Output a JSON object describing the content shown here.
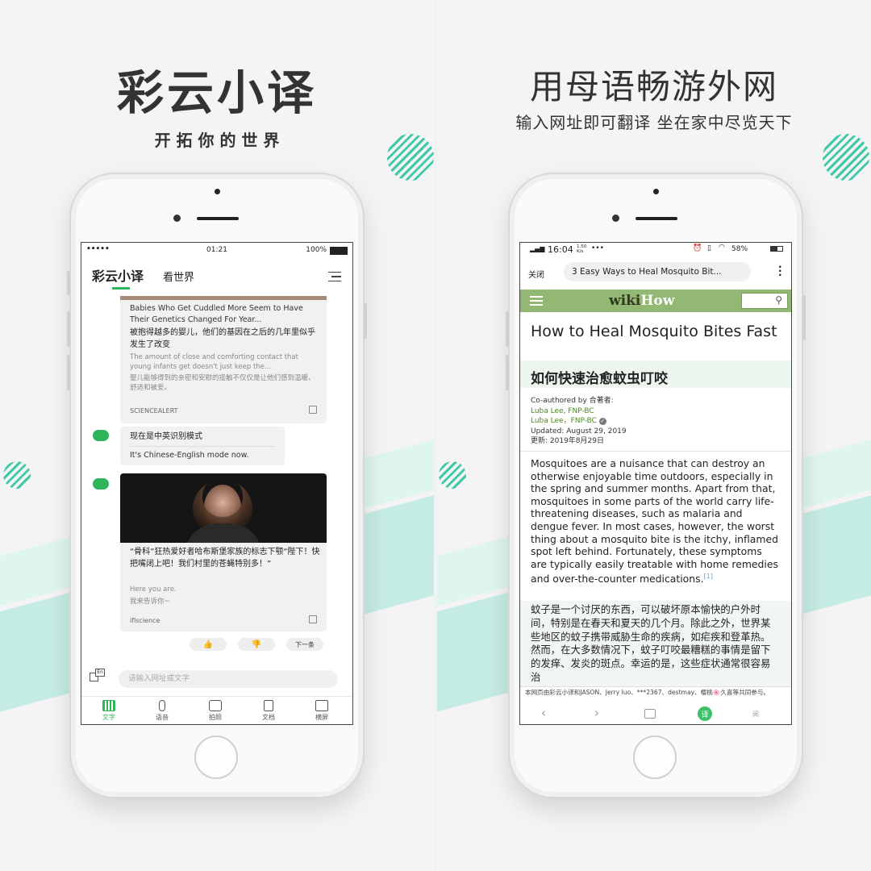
{
  "left_panel": {
    "title": "彩云小译",
    "subtitle": "开 拓 你 的 世 界",
    "status": {
      "signal": "•••••",
      "time": "01:21",
      "battery": "100%"
    },
    "header": {
      "app_name": "彩云小译",
      "section": "看世界"
    },
    "card1": {
      "title_en": "Babies Who Get Cuddled More Seem to Have Their Genetics Changed For Year...",
      "title_zh": "被抱得越多的婴儿，他们的基因在之后的几年里似乎发生了改变",
      "body_en": "The amount of close and comforting contact that young infants get doesn't just keep the...",
      "body_zh": "婴儿能够得到的亲密和安慰的接触不仅仅是让他们感到温暖、舒适和被爱。",
      "source": "SCIENCEALERT"
    },
    "bubble": {
      "zh": "现在是中英识别模式",
      "en": "It's Chinese-English mode now."
    },
    "card2": {
      "title_zh": "“骨科”狂热爱好者哈布斯堡家族的标志下颚“陛下！快把嘴闭上吧！我们村里的苍蝇特别多！”",
      "body_en": "Here you are.",
      "body_zh": "我来告诉你~",
      "source": "iflscience"
    },
    "next_label": "下一条",
    "input_placeholder": "请输入网址或文字",
    "lang_badge": "En",
    "nav": [
      {
        "label": "文字"
      },
      {
        "label": "语音"
      },
      {
        "label": "拍照"
      },
      {
        "label": "文档"
      },
      {
        "label": "横屏"
      }
    ],
    "accent": "#2fb45a"
  },
  "right_panel": {
    "title": "用母语畅游外网",
    "subtitle": "输入网址即可翻译 坐在家中尽览天下",
    "status": {
      "time": "16:04",
      "speed": "1.50 K/s",
      "extra": "•••",
      "battery": "58%"
    },
    "browser": {
      "close_label": "关闭",
      "url_title": "3 Easy Ways to Heal Mosquito Bit..."
    },
    "wikihow": {
      "logo_a": "wiki",
      "logo_b": "How",
      "bar_color": "#93b874"
    },
    "article": {
      "title_en": "How to Heal Mosquito Bites Fast",
      "title_zh": "如何快速治愈蚊虫叮咬",
      "coauthored": "Co-authored by 合著者:",
      "author1": "Luba Lee, FNP-BC",
      "author2": "Luba Lee，FNP-BC",
      "updated_en": "Updated: August 29, 2019",
      "updated_zh": "更新: 2019年8月29日",
      "para_en": "Mosquitoes are a nuisance that can destroy an otherwise enjoyable time outdoors, especially in the spring and summer months. Apart from that, mosquitoes in some parts of the world carry life-threatening diseases, such as malaria and dengue fever. In most cases, however, the worst thing about a mosquito bite is the itchy, inflamed spot left behind. Fortunately, these symptoms are typically easily treatable with home remedies and over-the-counter medications.",
      "ref": "[1]",
      "para_zh": "蚊子是一个讨厌的东西，可以破坏原本愉快的户外时间，特别是在春天和夏天的几个月。除此之外，世界某些地区的蚊子携带威胁生命的疾病，如疟疾和登革热。然而，在大多数情况下，蚊子叮咬最糟糕的事情是留下的发痒、发炎的斑点。幸运的是，这些症状通常很容易治",
      "credit": "本网页由彩云小译和JASON、Jerry luo、***2367、destmay、樱桃🌸久喜等共同参与。"
    },
    "translate_btn": "译",
    "read_label": "阅"
  }
}
